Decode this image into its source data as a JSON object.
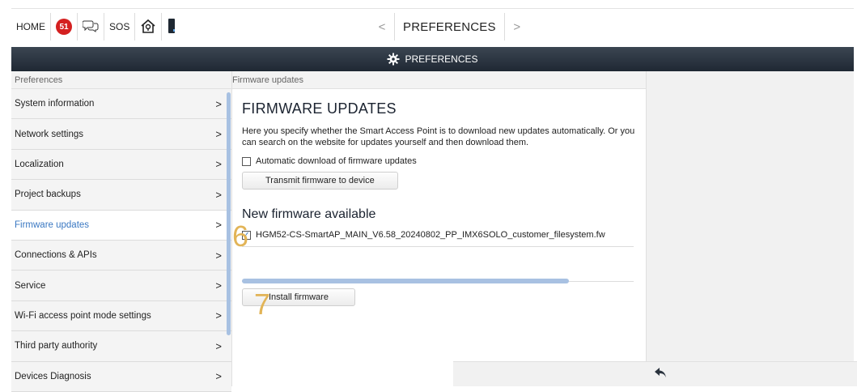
{
  "topbar": {
    "home_label": "HOME",
    "notification_count": "51",
    "sos_label": "SOS",
    "title": "PREFERENCES",
    "prev_glyph": "<",
    "next_glyph": ">"
  },
  "header": {
    "title": "PREFERENCES"
  },
  "sidebar": {
    "section_label": "Preferences",
    "arrow_glyph": ">",
    "items": [
      {
        "label": "System information"
      },
      {
        "label": "Network settings"
      },
      {
        "label": "Localization"
      },
      {
        "label": "Project backups"
      },
      {
        "label": "Firmware updates",
        "active": true
      },
      {
        "label": "Connections & APIs"
      },
      {
        "label": "Service"
      },
      {
        "label": "Wi-Fi access point mode settings"
      },
      {
        "label": "Third party authority"
      },
      {
        "label": "Devices Diagnosis"
      }
    ]
  },
  "main": {
    "section_label": "Firmware updates",
    "title": "FIRMWARE UPDATES",
    "description": "Here you specify whether the Smart Access Point is to download new updates automatically. Or you can search on the website for updates yourself and then download them.",
    "auto_download_label": "Automatic download of firmware updates",
    "auto_download_checked": false,
    "transmit_button": "Transmit firmware to device",
    "new_firmware_heading": "New firmware available",
    "firmware_file": "HGM52-CS-SmartAP_MAIN_V6.58_20240802_PP_IMX6SOLO_customer_filesystem.fw",
    "firmware_file_checked": true,
    "progress_percent": 83.5,
    "install_button": "Install firmware"
  },
  "annotations": {
    "step_6": "6",
    "step_7": "7"
  },
  "colors": {
    "accent": "#3a78c2",
    "header_bg": "#2a333e",
    "badge": "#d42020",
    "progress": "#a8c1e2",
    "step_marker": "#e2b457"
  },
  "icons": {
    "notifications": "badge-icon",
    "messages": "chat-bubbles-icon",
    "home": "house-icon",
    "device": "phone-icon",
    "settings": "gear-icon",
    "back": "back-arrow-icon"
  }
}
